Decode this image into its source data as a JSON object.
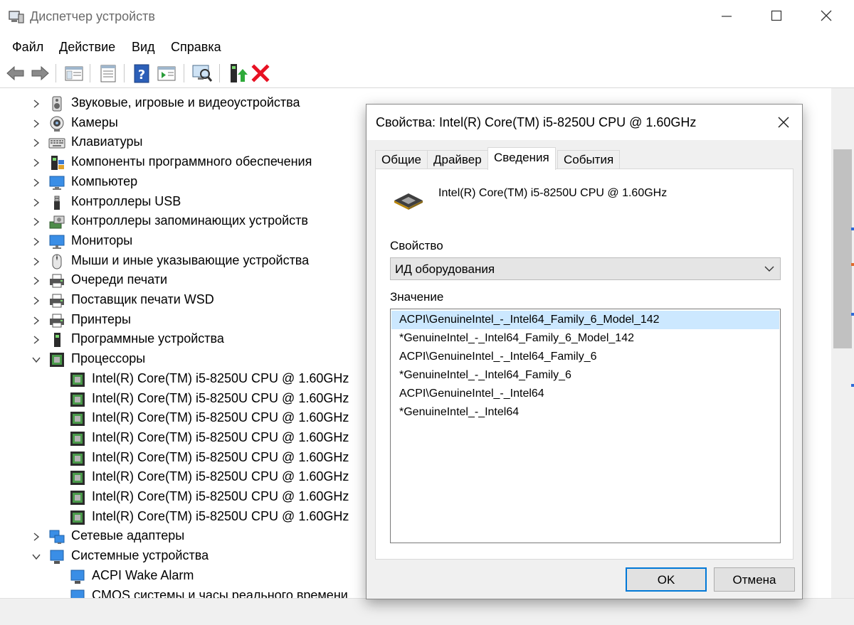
{
  "window": {
    "title": "Диспетчер устройств",
    "icon": "device-manager-icon"
  },
  "menu": [
    "Файл",
    "Действие",
    "Вид",
    "Справка"
  ],
  "tree": {
    "categories_before": [
      {
        "label": "Звуковые, игровые и видеоустройства",
        "icon": "speaker-icon"
      },
      {
        "label": "Камеры",
        "icon": "camera-icon"
      },
      {
        "label": "Клавиатуры",
        "icon": "keyboard-icon"
      },
      {
        "label": "Компоненты программного обеспечения",
        "icon": "software-component-icon"
      },
      {
        "label": "Компьютер",
        "icon": "computer-icon"
      },
      {
        "label": "Контроллеры USB",
        "icon": "usb-icon"
      },
      {
        "label": "Контроллеры запоминающих устройств",
        "icon": "storage-controller-icon"
      },
      {
        "label": "Мониторы",
        "icon": "monitor-icon"
      },
      {
        "label": "Мыши и иные указывающие устройства",
        "icon": "mouse-icon"
      },
      {
        "label": "Очереди печати",
        "icon": "printer-icon"
      },
      {
        "label": "Поставщик печати WSD",
        "icon": "printer-icon"
      },
      {
        "label": "Принтеры",
        "icon": "printer-icon"
      },
      {
        "label": "Программные устройства",
        "icon": "software-device-icon"
      }
    ],
    "processors": {
      "label": "Процессоры",
      "icon": "processor-icon",
      "children": [
        "Intel(R) Core(TM) i5-8250U CPU @ 1.60GHz",
        "Intel(R) Core(TM) i5-8250U CPU @ 1.60GHz",
        "Intel(R) Core(TM) i5-8250U CPU @ 1.60GHz",
        "Intel(R) Core(TM) i5-8250U CPU @ 1.60GHz",
        "Intel(R) Core(TM) i5-8250U CPU @ 1.60GHz",
        "Intel(R) Core(TM) i5-8250U CPU @ 1.60GHz",
        "Intel(R) Core(TM) i5-8250U CPU @ 1.60GHz",
        "Intel(R) Core(TM) i5-8250U CPU @ 1.60GHz"
      ]
    },
    "network": {
      "label": "Сетевые адаптеры",
      "icon": "network-adapter-icon"
    },
    "system": {
      "label": "Системные устройства",
      "icon": "system-device-icon",
      "children": [
        "ACPI Wake Alarm",
        "CMOS системы и часы реального времени"
      ]
    }
  },
  "dialog": {
    "title": "Свойства: Intel(R) Core(TM) i5-8250U CPU @ 1.60GHz",
    "tabs": [
      "Общие",
      "Драйвер",
      "Сведения",
      "События"
    ],
    "active_tab": "Сведения",
    "device_name": "Intel(R) Core(TM) i5-8250U CPU @ 1.60GHz",
    "property_label": "Свойство",
    "property_value": "ИД оборудования",
    "value_label": "Значение",
    "values": [
      "ACPI\\GenuineIntel_-_Intel64_Family_6_Model_142",
      "*GenuineIntel_-_Intel64_Family_6_Model_142",
      "ACPI\\GenuineIntel_-_Intel64_Family_6",
      "*GenuineIntel_-_Intel64_Family_6",
      "ACPI\\GenuineIntel_-_Intel64",
      "*GenuineIntel_-_Intel64"
    ],
    "selected_value_index": 0,
    "ok_label": "OK",
    "cancel_label": "Отмена"
  },
  "colors": {
    "selection": "#cce8ff",
    "accent": "#0078d7",
    "delete_red": "#e81123"
  }
}
